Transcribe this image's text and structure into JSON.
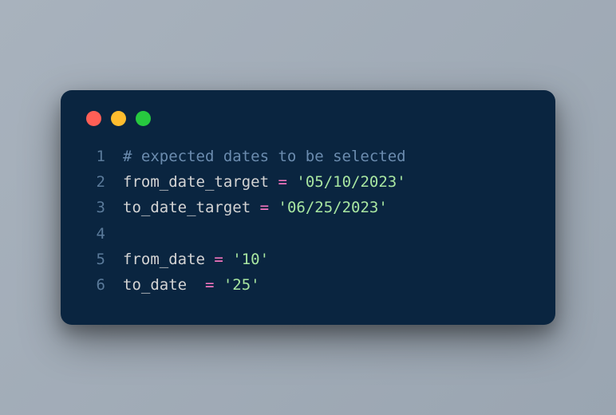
{
  "colors": {
    "bg_editor": "#0a2540",
    "red": "#ff5f56",
    "yellow": "#ffbd2e",
    "green": "#27c93f",
    "lineno": "#5a7a9a",
    "comment": "#6b8caf",
    "ident": "#d4d4d4",
    "op": "#ff79c6",
    "string": "#a8e6a1"
  },
  "code": {
    "lines": [
      {
        "n": "1",
        "tokens": [
          {
            "cls": "comment",
            "t": "# expected dates to be selected"
          }
        ]
      },
      {
        "n": "2",
        "tokens": [
          {
            "cls": "ident",
            "t": "from_date_target "
          },
          {
            "cls": "op",
            "t": "="
          },
          {
            "cls": "ident",
            "t": " "
          },
          {
            "cls": "string",
            "t": "'05/10/2023'"
          }
        ]
      },
      {
        "n": "3",
        "tokens": [
          {
            "cls": "ident",
            "t": "to_date_target "
          },
          {
            "cls": "op",
            "t": "="
          },
          {
            "cls": "ident",
            "t": " "
          },
          {
            "cls": "string",
            "t": "'06/25/2023'"
          }
        ]
      },
      {
        "n": "4",
        "tokens": []
      },
      {
        "n": "5",
        "tokens": [
          {
            "cls": "ident",
            "t": "from_date "
          },
          {
            "cls": "op",
            "t": "="
          },
          {
            "cls": "ident",
            "t": " "
          },
          {
            "cls": "string",
            "t": "'10'"
          }
        ]
      },
      {
        "n": "6",
        "tokens": [
          {
            "cls": "ident",
            "t": "to_date  "
          },
          {
            "cls": "op",
            "t": "="
          },
          {
            "cls": "ident",
            "t": " "
          },
          {
            "cls": "string",
            "t": "'25'"
          }
        ]
      }
    ]
  }
}
